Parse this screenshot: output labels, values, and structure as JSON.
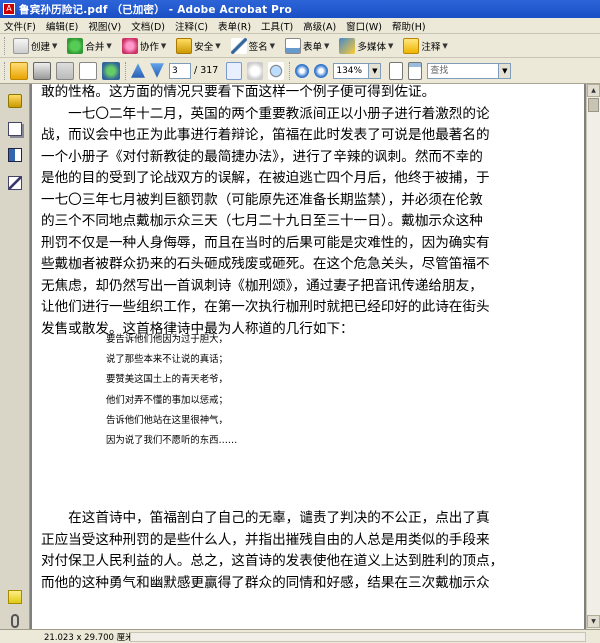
{
  "window": {
    "title": "鲁宾孙历险记.pdf （已加密） - Adobe Acrobat Pro"
  },
  "menu": [
    "文件(F)",
    "编辑(E)",
    "视图(V)",
    "文档(D)",
    "注释(C)",
    "表单(R)",
    "工具(T)",
    "高级(A)",
    "窗口(W)",
    "帮助(H)"
  ],
  "toolbar1": {
    "create": "创建",
    "combine": "合并",
    "collaborate": "协作",
    "secure": "安全",
    "sign": "签名",
    "forms": "表单",
    "multimedia": "多媒体",
    "comment": "注释"
  },
  "toolbar2": {
    "page_current": "3",
    "page_total": "/ 317",
    "zoom": "134%",
    "find_placeholder": "查找"
  },
  "document": {
    "paragraph1": [
      "敢的性格。这方面的情况只要看下面这样一个例子便可得到佐证。",
      "　　一七〇二年十二月，英国的两个重要教派间正以小册子进行着激烈的论",
      "战，而议会中也正为此事进行着辩论，笛福在此时发表了可说是他最著名的",
      "一个小册子《对付新教徒的最简捷办法》，进行了辛辣的讽刺。然而不幸的",
      "是他的目的受到了论战双方的误解，在被迫逃亡四个月后，他终于被捕，于",
      "一七〇三年七月被判巨额罚款（可能原先还准备长期监禁），并必须在伦敦",
      "的三个不同地点戴枷示众三天（七月二十九日至三十一日）。戴枷示众这种",
      "刑罚不仅是一种人身侮辱，而且在当时的后果可能是灾难性的，因为确实有",
      "些戴枷者被群众扔来的石头砸成残废或砸死。在这个危急关头，尽管笛福不",
      "无焦虑，却仍然写出一首讽刺诗《枷刑颂》，通过妻子把音讯传递给朋友，",
      "让他们进行一些组织工作，在第一次执行枷刑时就把已经印好的此诗在街头",
      "发售或散发。这首格律诗中最为人称道的几行如下："
    ],
    "poem": [
      "要告诉他们他因为过于胆大，",
      "说了那些本来不让说的真话；",
      "要赞美这国土上的青天老爷，",
      "他们对弄不懂的事加以惩戒；",
      "告诉他们他站在这里很神气，",
      "因为说了我们不愿听的东西……"
    ],
    "paragraph2": [
      "　　在这首诗中，笛福剖白了自己的无辜，谴责了判决的不公正，点出了真",
      "正应当受这种刑罚的是些什么人，并指出摧残自由的人总是用类似的手段来",
      "对付保卫人民利益的人。总之，这首诗的发表使他在道义上达到胜利的顶点，",
      "而他的这种勇气和幽默感更赢得了群众的同情和好感，结果在三次戴枷示众"
    ]
  },
  "status": {
    "page_size": "21.023 x 29.700 厘米"
  }
}
